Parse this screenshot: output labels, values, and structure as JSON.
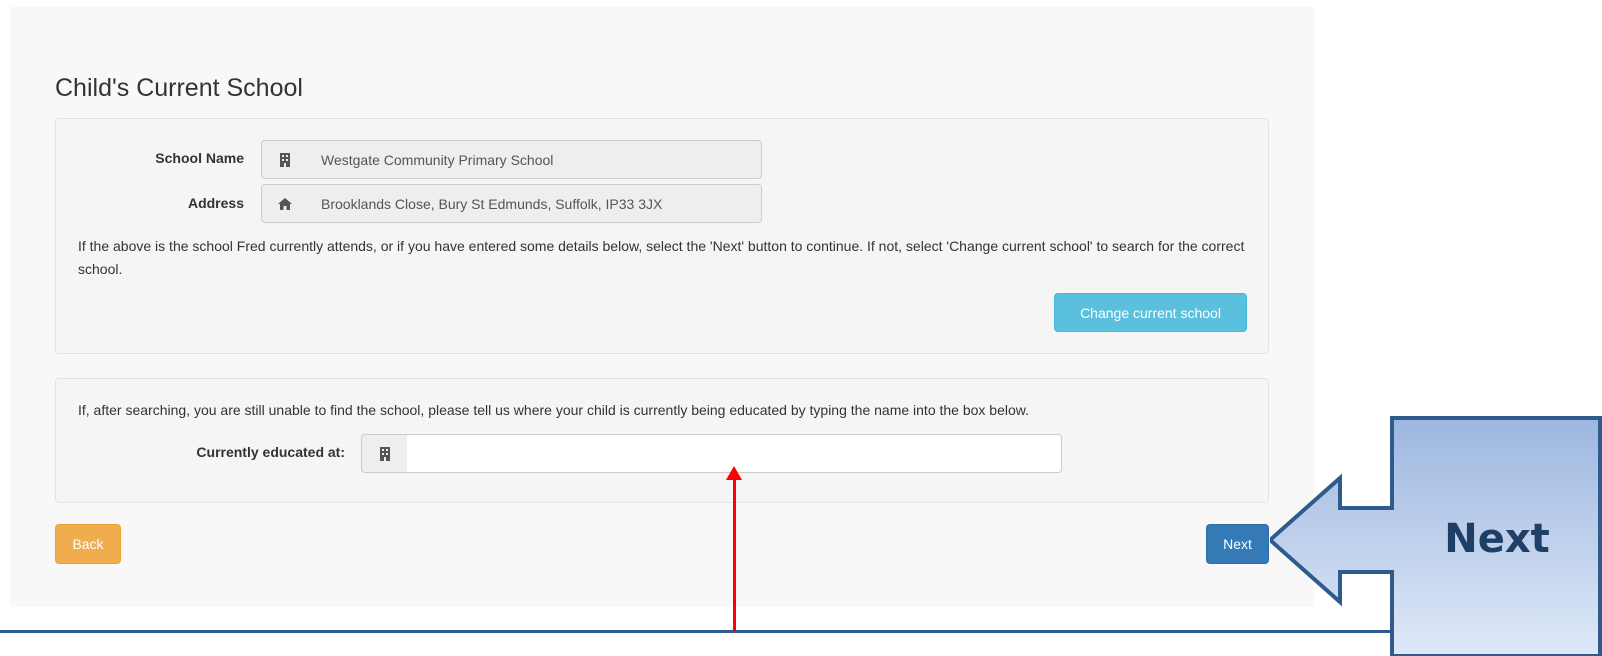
{
  "section_title": "Child's Current School",
  "current_school": {
    "school_name_label": "School Name",
    "school_name_value": "Westgate Community Primary School",
    "school_icon": "building-icon",
    "address_label": "Address",
    "address_value": "Brooklands Close, Bury St Edmunds, Suffolk, IP33 3JX",
    "address_icon": "home-icon",
    "help_text": "If the above is the school Fred currently attends, or if you have entered some details below, select the 'Next' button to continue. If not, select 'Change current school' to search for the correct school.",
    "change_button": "Change current school"
  },
  "manual_entry": {
    "help_text": "If, after searching, you are still unable to find the school, please tell us where your child is currently being educated by typing the name into the box below.",
    "educated_at_label": "Currently educated at:",
    "educated_at_value": "",
    "educated_at_icon": "building-icon"
  },
  "nav": {
    "back_button": "Back",
    "next_button": "Next"
  },
  "annotation": {
    "callout_label": "Next",
    "callout_color": "#b4c7e7",
    "callout_border": "#2f5a8c",
    "pointer_color": "#ff0000"
  },
  "colors": {
    "info": "#5bc0de",
    "warning": "#f0ad4e",
    "primary": "#337ab7"
  }
}
